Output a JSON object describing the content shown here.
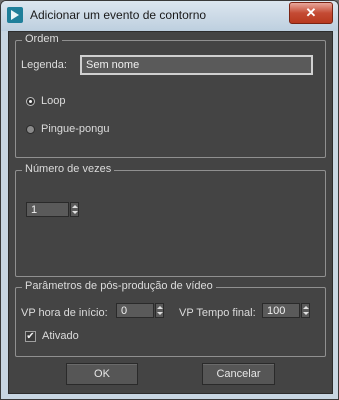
{
  "window": {
    "title": "Adicionar um evento de contorno",
    "close_glyph": "✕"
  },
  "ordem": {
    "group_label": "Ordem",
    "legend_label": "Legenda:",
    "legend_value": "Sem nome",
    "loop_label": "Loop",
    "pingpong_label": "Pingue-pongu",
    "selected": "Loop"
  },
  "repeats": {
    "group_label": "Número de vezes",
    "value": "1"
  },
  "video": {
    "group_label": "Parâmetros de pós-produção de vídeo",
    "start_label": "VP hora de início:",
    "start_value": "0",
    "end_label": "VP Tempo final:",
    "end_value": "100",
    "enabled_label": "Ativado",
    "enabled": true
  },
  "buttons": {
    "ok": "OK",
    "cancel": "Cancelar"
  },
  "icons": {
    "app": "app-icon",
    "close": "close-icon",
    "checkmark": "✔"
  },
  "colors": {
    "panel": "#444444",
    "field": "#5a5a5a",
    "close_button": "#c44b34"
  }
}
